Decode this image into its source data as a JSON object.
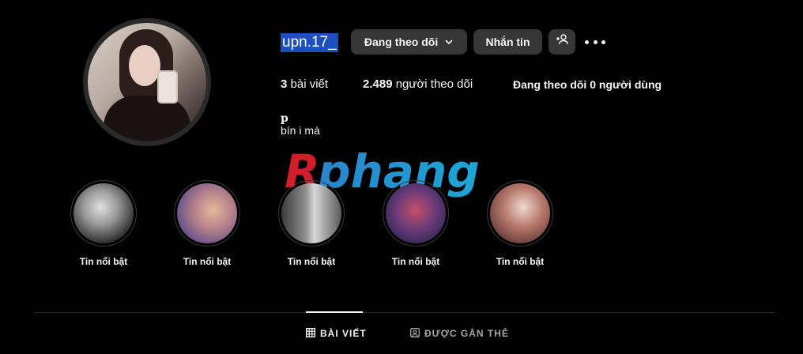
{
  "profile": {
    "username": "upn.17_",
    "full_name": "p",
    "bio": "bín i má"
  },
  "actions": {
    "following_label": "Đang theo dõi",
    "message_label": "Nhắn tin",
    "add_user_icon": "add-person-icon",
    "more_icon": "more-horizontal-icon"
  },
  "stats": {
    "posts_count": "3",
    "posts_label": "bài viết",
    "followers_count": "2.489",
    "followers_label": "người theo dõi",
    "following_text": "Đang theo dõi 0 người dùng"
  },
  "watermark": "Rphang",
  "highlights": [
    {
      "label": "Tin nổi bật"
    },
    {
      "label": "Tin nổi bật"
    },
    {
      "label": "Tin nổi bật"
    },
    {
      "label": "Tin nổi bật"
    },
    {
      "label": "Tin nổi bật"
    }
  ],
  "tabs": {
    "posts_label": "BÀI VIẾT",
    "tagged_label": "ĐƯỢC GẮN THẺ"
  },
  "colors": {
    "background": "#000000",
    "button_bg": "#363636",
    "username_highlight": "#1c4fbf"
  }
}
